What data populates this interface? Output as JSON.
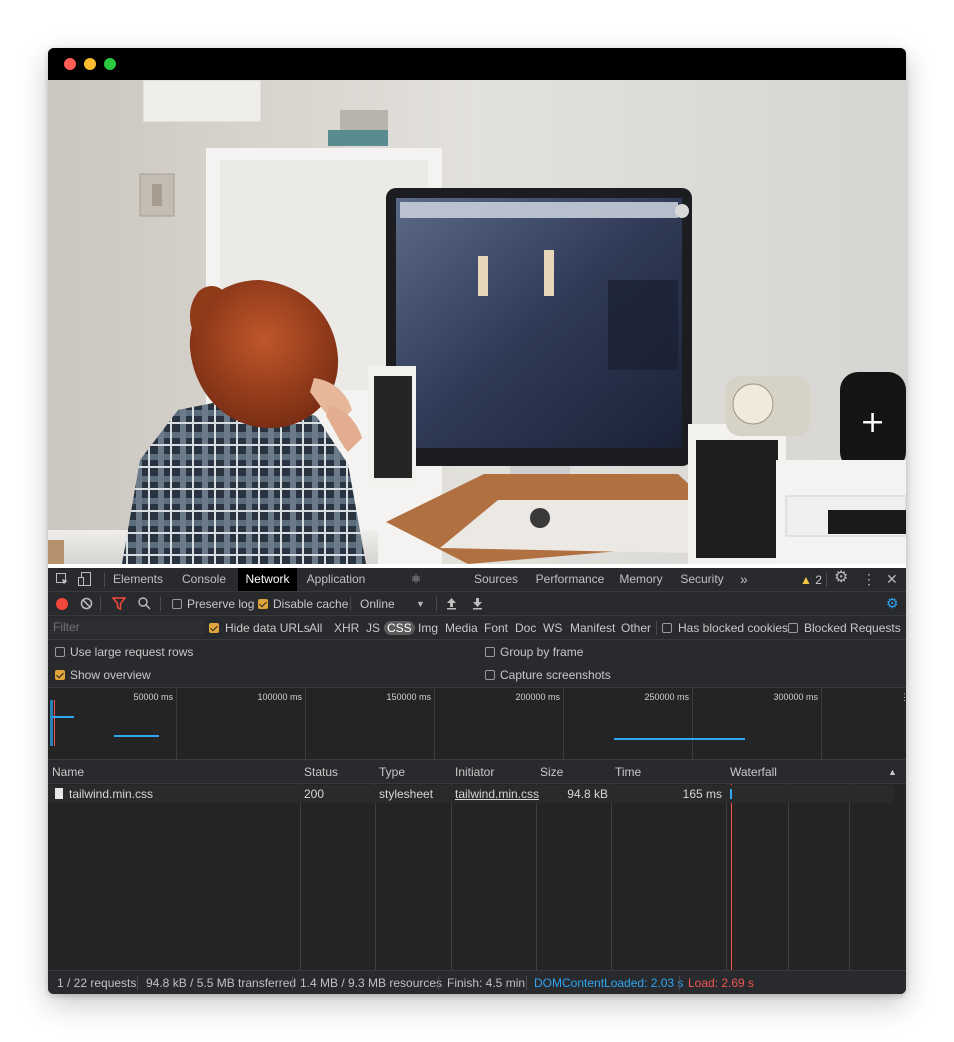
{
  "colors": {
    "close": "#ff5f57",
    "minimize": "#febc2e",
    "maximize": "#28c840",
    "record": "#f1473c",
    "accent_blue": "#2ea6f2",
    "load_red": "#f05550",
    "checkbox_on": "#e0a53b"
  },
  "photo": {
    "alt": "Woman with red hair in a plaid shirt looking at a computer monitor"
  },
  "tabs": [
    "Elements",
    "Console",
    "Network",
    "Application",
    "Components",
    "Sources",
    "Performance",
    "Memory",
    "Security"
  ],
  "active_tab": "Network",
  "more_tabs": "»",
  "warnings_count": "2",
  "toolbar": {
    "preserve_log": "Preserve log",
    "preserve_log_checked": false,
    "disable_cache": "Disable cache",
    "disable_cache_checked": true,
    "throttle": "Online"
  },
  "filter": {
    "placeholder": "Filter",
    "hide_data_urls": "Hide data URLs",
    "hide_data_urls_checked": true,
    "types": [
      "All",
      "XHR",
      "JS",
      "CSS",
      "Img",
      "Media",
      "Font",
      "Doc",
      "WS",
      "Manifest",
      "Other"
    ],
    "selected_type": "CSS",
    "has_blocked_cookies": "Has blocked cookies",
    "blocked_requests": "Blocked Requests"
  },
  "settings": {
    "large_rows": "Use large request rows",
    "large_rows_checked": false,
    "group_by_frame": "Group by frame",
    "group_by_frame_checked": false,
    "show_overview": "Show overview",
    "show_overview_checked": true,
    "capture_screenshots": "Capture screenshots",
    "capture_screenshots_checked": false
  },
  "overview": {
    "ticks": [
      "50000 ms",
      "100000 ms",
      "150000 ms",
      "200000 ms",
      "250000 ms",
      "300000 ms"
    ]
  },
  "table": {
    "columns": [
      "Name",
      "Status",
      "Type",
      "Initiator",
      "Size",
      "Time",
      "Waterfall"
    ],
    "rows": [
      {
        "name": "tailwind.min.css",
        "status": "200",
        "type": "stylesheet",
        "initiator": "tailwind.min.css",
        "size": "94.8 kB",
        "time": "165 ms"
      }
    ]
  },
  "status": {
    "requests": "1 / 22 requests",
    "transferred": "94.8 kB / 5.5 MB transferred",
    "resources": "1.4 MB / 9.3 MB resources",
    "finish": "Finish: 4.5 min",
    "dom_content_loaded": "DOMContentLoaded: 2.03 s",
    "load": "Load: 2.69 s"
  }
}
